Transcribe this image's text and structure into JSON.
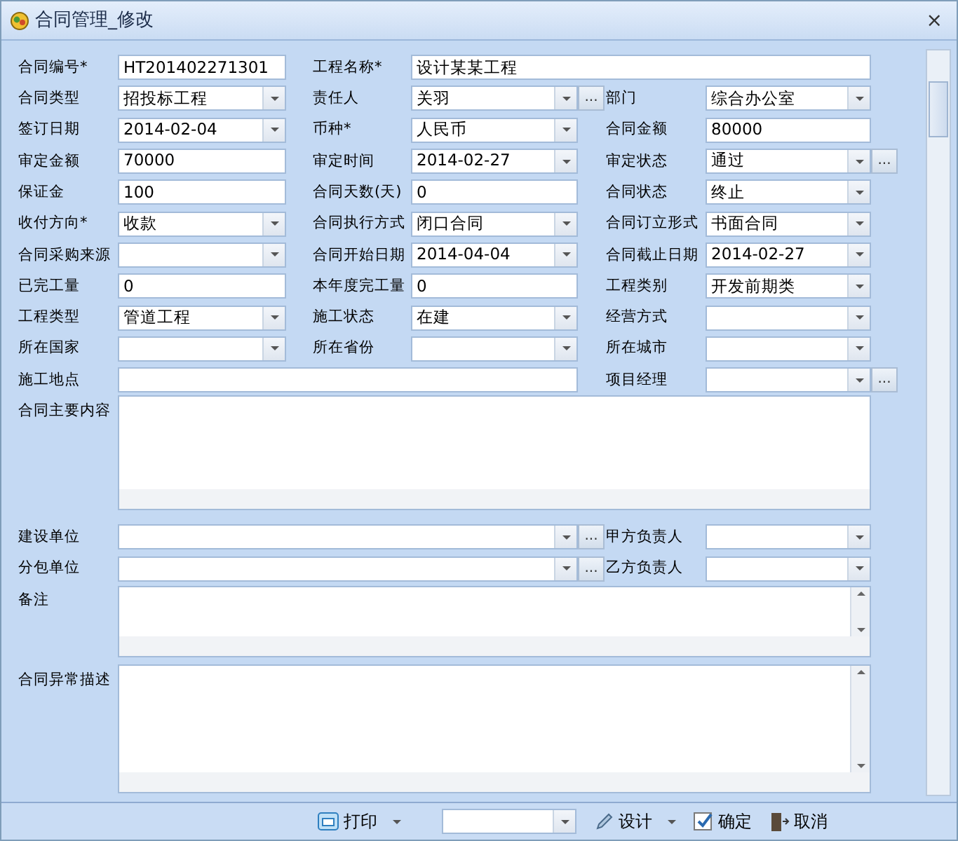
{
  "window": {
    "title": "合同管理_修改",
    "close": "×"
  },
  "rows": [
    {
      "items": [
        {
          "label": "合同编号*",
          "kind": "text",
          "value": "HT201402271301"
        },
        {
          "label": "工程名称*",
          "kind": "wide-text",
          "value": "设计某某工程"
        }
      ]
    },
    {
      "items": [
        {
          "label": "合同类型",
          "kind": "combo",
          "value": "招投标工程"
        },
        {
          "label": "责任人",
          "kind": "combo",
          "value": "关羽",
          "button": "..."
        },
        {
          "label": "部门",
          "kind": "combo",
          "value": "综合办公室"
        }
      ]
    },
    {
      "items": [
        {
          "label": "签订日期",
          "kind": "combo",
          "value": "2014-02-04"
        },
        {
          "label": "币种*",
          "kind": "combo",
          "value": "人民币"
        },
        {
          "label": "合同金额",
          "kind": "text",
          "value": "80000"
        }
      ]
    },
    {
      "items": [
        {
          "label": "审定金额",
          "kind": "text",
          "value": "70000"
        },
        {
          "label": "审定时间",
          "kind": "combo",
          "value": "2014-02-27"
        },
        {
          "label": "审定状态",
          "kind": "combo",
          "value": "通过",
          "button": "..."
        }
      ]
    },
    {
      "items": [
        {
          "label": "保证金",
          "kind": "text",
          "value": "100"
        },
        {
          "label": "合同天数(天)",
          "kind": "text",
          "value": "0"
        },
        {
          "label": "合同状态",
          "kind": "combo",
          "value": "终止"
        }
      ]
    },
    {
      "items": [
        {
          "label": "收付方向*",
          "kind": "combo",
          "value": "收款"
        },
        {
          "label": "合同执行方式",
          "kind": "combo",
          "value": "闭口合同"
        },
        {
          "label": "合同订立形式",
          "kind": "combo",
          "value": "书面合同"
        }
      ]
    },
    {
      "items": [
        {
          "label": "合同采购来源",
          "kind": "combo"
        },
        {
          "label": "合同开始日期",
          "kind": "combo",
          "value": "2014-04-04"
        },
        {
          "label": "合同截止日期",
          "kind": "combo",
          "value": "2014-02-27"
        }
      ]
    },
    {
      "items": [
        {
          "label": "已完工量",
          "kind": "text",
          "value": "0"
        },
        {
          "label": "本年度完工量",
          "kind": "text",
          "value": "0"
        },
        {
          "label": "工程类别",
          "kind": "combo",
          "value": "开发前期类"
        }
      ]
    },
    {
      "items": [
        {
          "label": "工程类型",
          "kind": "combo",
          "value": "管道工程"
        },
        {
          "label": "施工状态",
          "kind": "combo",
          "value": "在建"
        },
        {
          "label": "经营方式",
          "kind": "combo"
        }
      ]
    },
    {
      "items": [
        {
          "label": "所在国家",
          "kind": "combo"
        },
        {
          "label": "所在省份",
          "kind": "combo"
        },
        {
          "label": "所在城市",
          "kind": "combo"
        }
      ]
    },
    {
      "items": [
        {
          "label": "施工地点",
          "kind": "wide-text"
        },
        {
          "label": "项目经理",
          "kind": "combo",
          "button": "..."
        }
      ]
    },
    {
      "items": [
        {
          "label": "合同主要内容",
          "kind": "textarea"
        }
      ]
    },
    {
      "items": [
        {
          "label": "建设单位",
          "kind": "wide-combo",
          "button": "..."
        },
        {
          "label": "甲方负责人",
          "kind": "combo"
        }
      ]
    },
    {
      "items": [
        {
          "label": "分包单位",
          "kind": "wide-combo",
          "button": "..."
        },
        {
          "label": "乙方负责人",
          "kind": "combo"
        }
      ]
    },
    {
      "items": [
        {
          "label": "备注",
          "kind": "textarea"
        }
      ]
    },
    {
      "items": [
        {
          "label": "合同异常描述",
          "kind": "textarea"
        }
      ]
    }
  ],
  "toolbar": [
    {
      "kind": "menu-button",
      "label": "打印"
    },
    {
      "kind": "combo"
    },
    {
      "kind": "menu-button",
      "label": "设计"
    },
    {
      "kind": "button",
      "label": "确定"
    },
    {
      "kind": "button",
      "label": "取消"
    }
  ]
}
